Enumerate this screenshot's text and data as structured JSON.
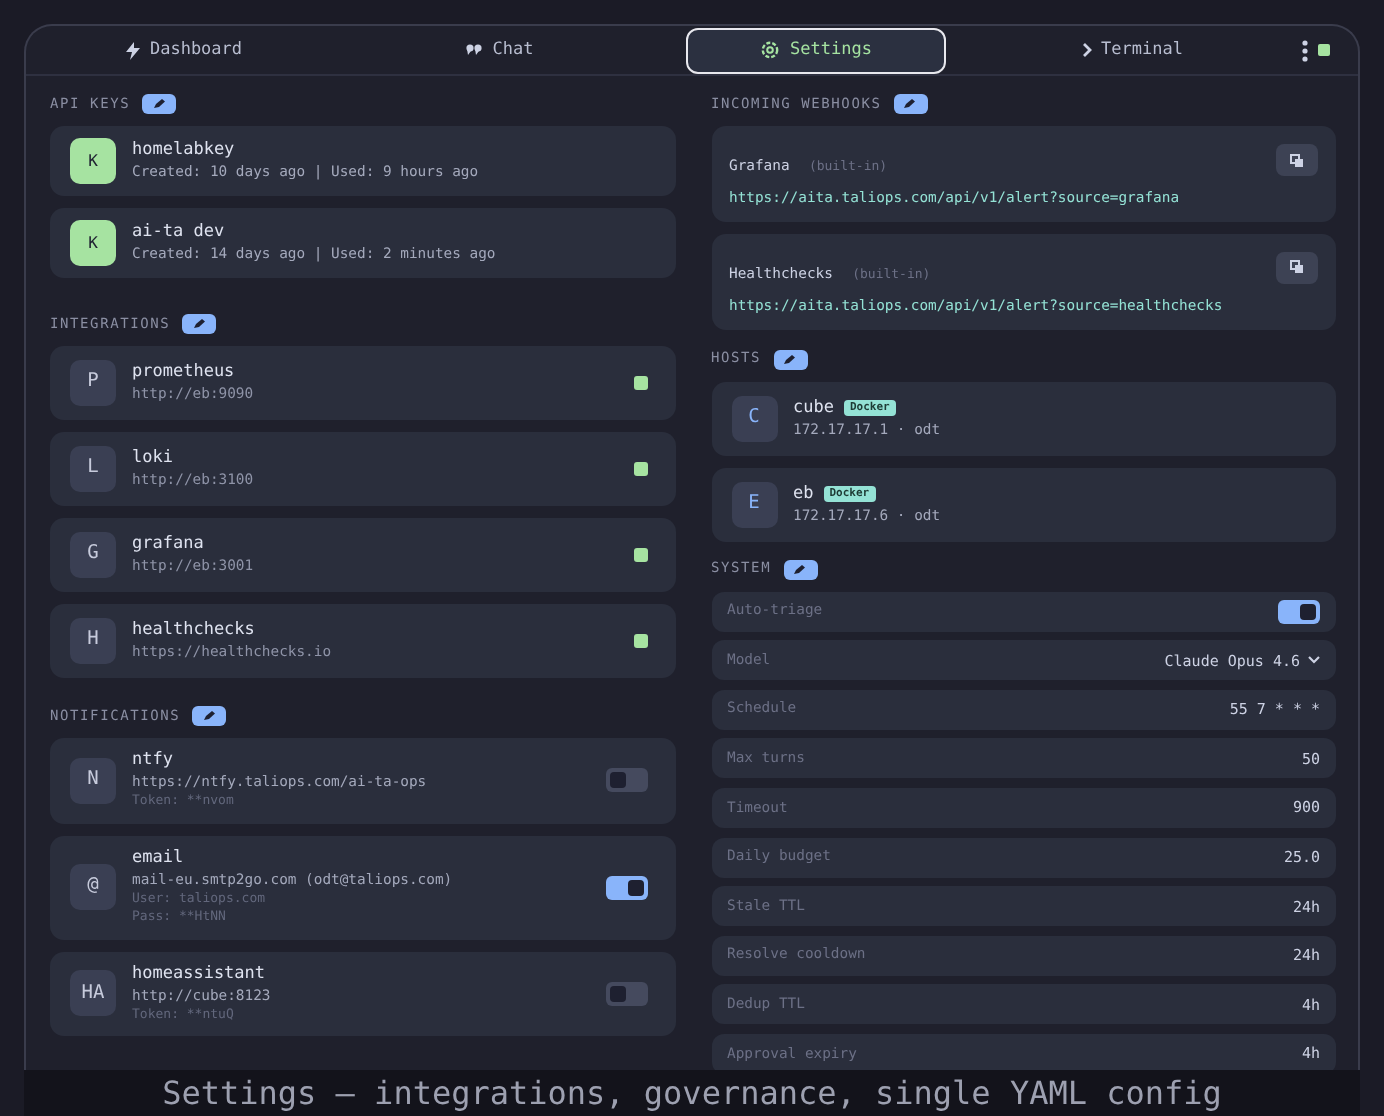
{
  "tabs": [
    {
      "label": "Dashboard",
      "selected": false
    },
    {
      "label": "Chat",
      "selected": false
    },
    {
      "label": "Settings",
      "selected": true
    },
    {
      "label": "Terminal",
      "selected": false
    }
  ],
  "connection": {
    "online": true
  },
  "api_keys": {
    "title": "API KEYS",
    "items": [
      {
        "initial": "K",
        "name": "homelabkey",
        "meta": "Created: 10 days ago | Used: 9 hours ago"
      },
      {
        "initial": "K",
        "name": "ai-ta dev",
        "meta": "Created: 14 days ago | Used: 2 minutes ago"
      }
    ]
  },
  "integrations": {
    "title": "INTEGRATIONS",
    "items": [
      {
        "initial": "P",
        "name": "prometheus",
        "url": "http://eb:9090",
        "connected": true
      },
      {
        "initial": "L",
        "name": "loki",
        "url": "http://eb:3100",
        "connected": true
      },
      {
        "initial": "G",
        "name": "grafana",
        "url": "http://eb:3001",
        "connected": true
      },
      {
        "initial": "H",
        "name": "healthchecks",
        "url": "https://healthchecks.io",
        "connected": true
      }
    ]
  },
  "notifications": {
    "title": "NOTIFICATIONS",
    "items": [
      {
        "initial": "N",
        "name": "ntfy",
        "url": "https://ntfy.taliops.com/ai-ta-ops",
        "details": [
          "Token: **nvom"
        ],
        "enabled": false
      },
      {
        "initial": "@",
        "name": "email",
        "url": "mail-eu.smtp2go.com (odt@taliops.com)",
        "details": [
          "User: taliops.com",
          "Pass: **HtNN"
        ],
        "enabled": true
      },
      {
        "initial": "HA",
        "name": "homeassistant",
        "url": "http://cube:8123",
        "details": [
          "Token: **ntuQ"
        ],
        "enabled": false
      }
    ]
  },
  "webhooks": {
    "title": "INCOMING WEBHOOKS",
    "items": [
      {
        "name": "Grafana",
        "tag": "(built-in)",
        "url": "https://aita.taliops.com/api/v1/alert?source=grafana"
      },
      {
        "name": "Healthchecks",
        "tag": "(built-in)",
        "url": "https://aita.taliops.com/api/v1/alert?source=healthchecks"
      }
    ]
  },
  "hosts": {
    "title": "HOSTS",
    "items": [
      {
        "initial": "C",
        "name": "cube",
        "badge": "Docker",
        "address": "172.17.17.1 · odt"
      },
      {
        "initial": "E",
        "name": "eb",
        "badge": "Docker",
        "address": "172.17.17.6 · odt"
      }
    ]
  },
  "system": {
    "title": "SYSTEM",
    "items": [
      {
        "kind": "toggle",
        "label": "Auto-triage",
        "on": true
      },
      {
        "kind": "select",
        "label": "Model",
        "value": "Claude Opus 4.6"
      },
      {
        "kind": "value",
        "label": "Schedule",
        "value": "55 7 * * *"
      },
      {
        "kind": "value",
        "label": "Max turns",
        "value": "50"
      },
      {
        "kind": "value",
        "label": "Timeout",
        "value": "900"
      },
      {
        "kind": "value",
        "label": "Daily budget",
        "value": "25.0"
      },
      {
        "kind": "value",
        "label": "Stale TTL",
        "value": "24h"
      },
      {
        "kind": "value",
        "label": "Resolve cooldown",
        "value": "24h"
      },
      {
        "kind": "value",
        "label": "Dedup TTL",
        "value": "4h"
      },
      {
        "kind": "value",
        "label": "Approval expiry",
        "value": "4h"
      }
    ]
  },
  "caption": "Settings — integrations, governance, single YAML config"
}
